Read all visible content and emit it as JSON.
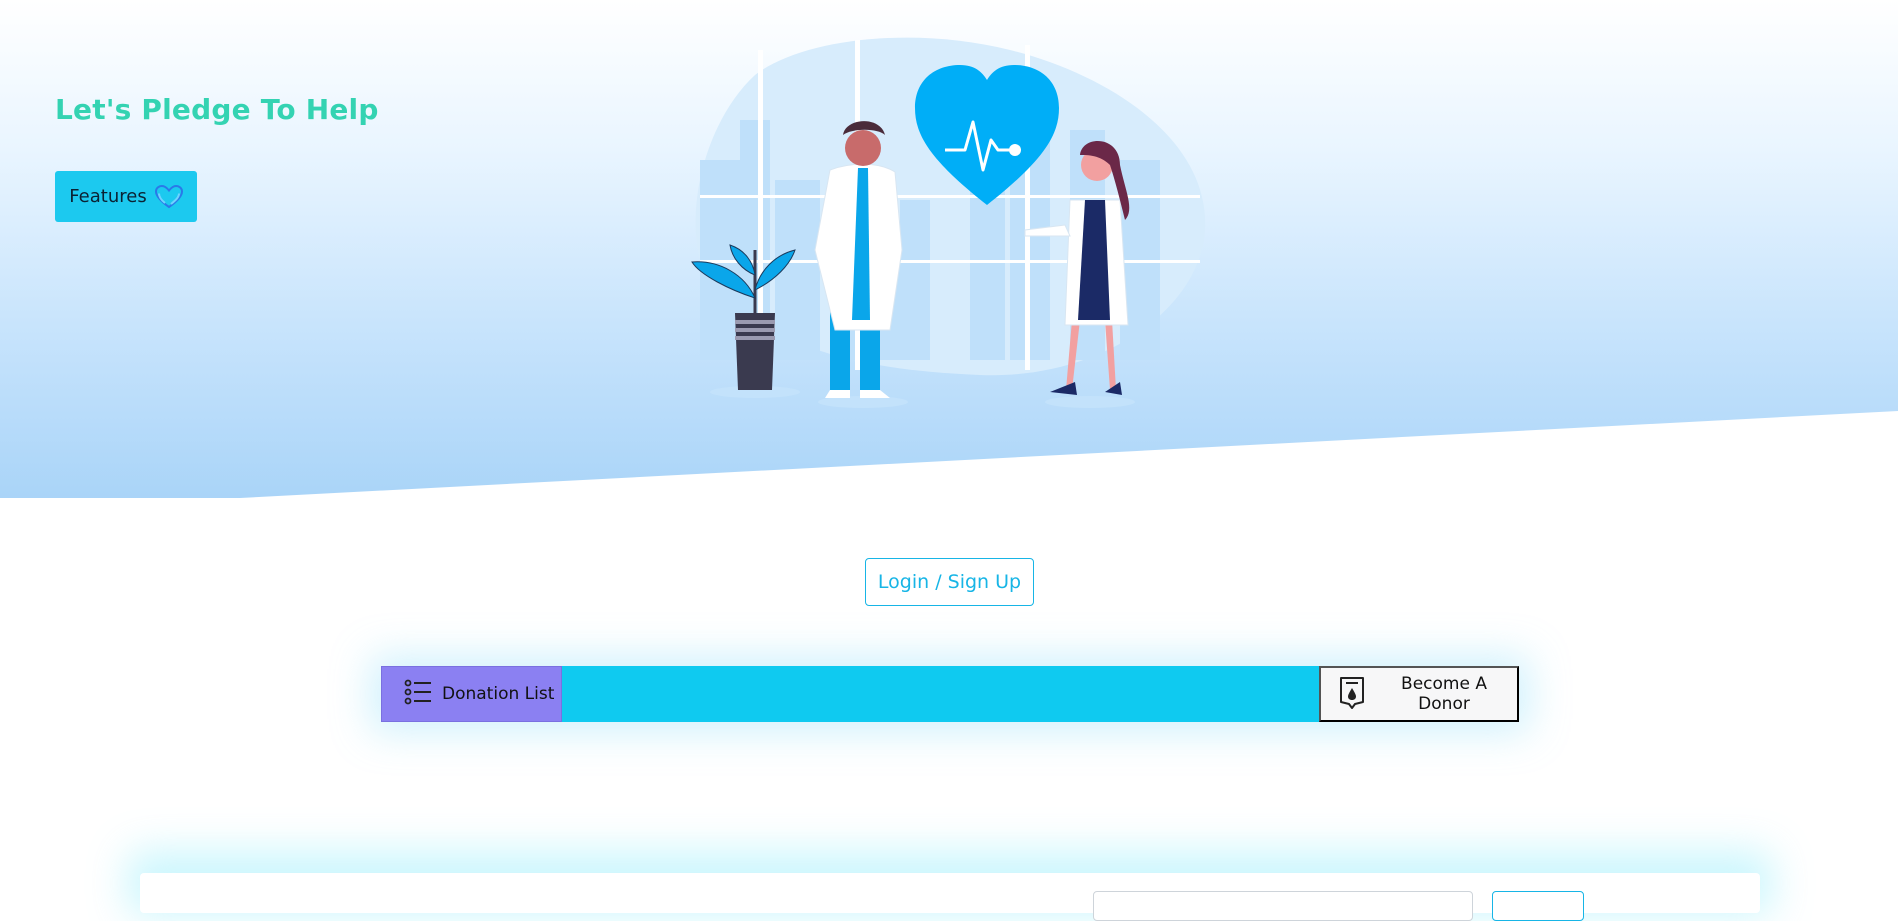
{
  "hero": {
    "title": "Let's Pledge To Help",
    "features_label": "Features"
  },
  "auth": {
    "login_label": "Login / Sign Up"
  },
  "actions": {
    "donation_list_label": "Donation List",
    "become_donor_label": "Become A Donor"
  },
  "icons": {
    "features": "heart-icon",
    "donation_list": "list-icon",
    "become_donor": "blood-bag-icon"
  },
  "colors": {
    "title": "#34d3b2",
    "primary": "#1cc9ef",
    "accent": "#00a8f5",
    "donation_list_bg": "#8b80f2",
    "login_border": "#17b5e6"
  }
}
